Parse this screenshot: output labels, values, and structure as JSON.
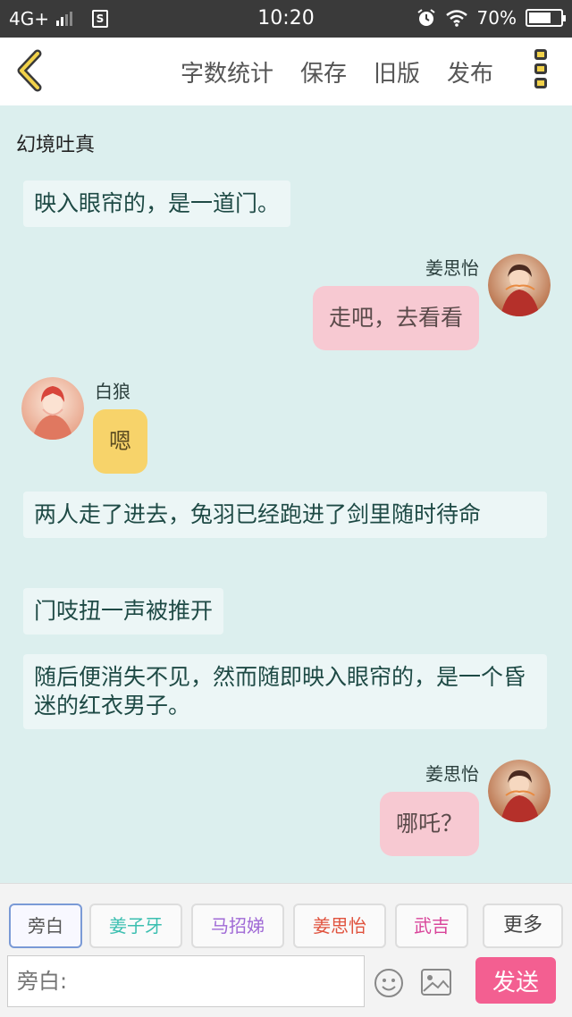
{
  "status_bar": {
    "network": "4G+",
    "sim_badge": "S",
    "time": "10:20",
    "battery": "70%",
    "battery_level": 0.7
  },
  "toolbar": {
    "word_count": "字数统计",
    "save": "保存",
    "old_version": "旧版",
    "publish": "发布"
  },
  "chat": {
    "title": "幻境吐真",
    "messages": [
      {
        "type": "narration",
        "text": "映入眼帘的，是一道门。"
      },
      {
        "type": "right",
        "speaker": "姜思怡",
        "text": "走吧，去看看"
      },
      {
        "type": "left",
        "speaker": "白狼",
        "text": "嗯"
      },
      {
        "type": "narration",
        "text": "两人走了进去，兔羽已经跑进了剑里随时待命"
      },
      {
        "type": "narration",
        "text": "门吱扭一声被推开"
      },
      {
        "type": "narration",
        "text": "随后便消失不见，然而随即映入眼帘的，是一个昏迷的红衣男子。"
      },
      {
        "type": "right",
        "speaker": "姜思怡",
        "text": "哪吒？"
      }
    ]
  },
  "roles": [
    {
      "label": "旁白",
      "color": "#555555"
    },
    {
      "label": "姜子牙",
      "color": "#3bbfb0"
    },
    {
      "label": "马招娣",
      "color": "#a06ad6"
    },
    {
      "label": "姜思怡",
      "color": "#e0533e"
    },
    {
      "label": "武吉",
      "color": "#d9449a"
    }
  ],
  "more_roles": "更多",
  "input": {
    "placeholder": "旁白:"
  },
  "send": "发送",
  "icons": {
    "back": "chevron-left-icon",
    "more": "vertical-menu-icon",
    "emoji": "smiley-icon",
    "image": "image-icon"
  }
}
